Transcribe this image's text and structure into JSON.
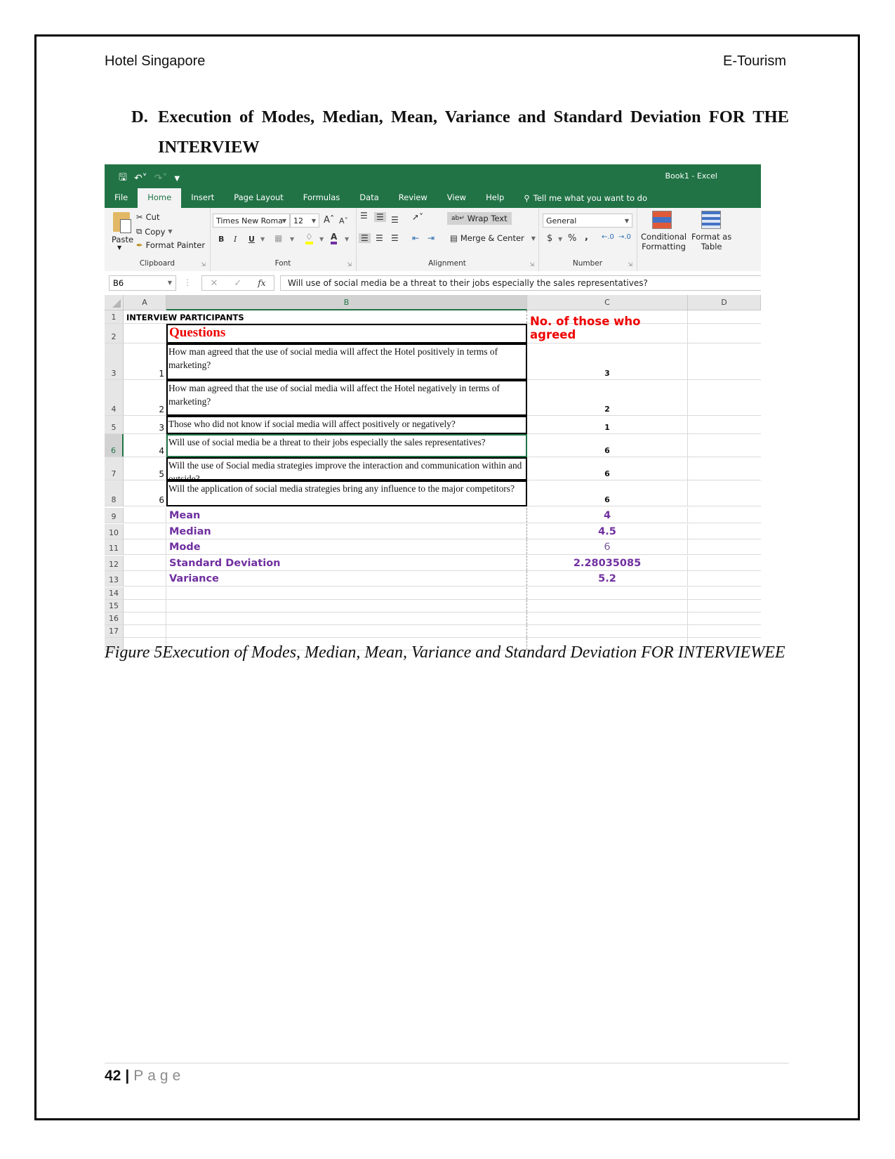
{
  "header": {
    "left": "Hotel Singapore",
    "right": "E-Tourism"
  },
  "heading": {
    "number": "D.",
    "text": "Execution of Modes, Median, Mean, Variance and Standard Deviation FOR THE INTERVIEW"
  },
  "excel": {
    "window_title": "Book1  -  Excel",
    "tabs": [
      "File",
      "Home",
      "Insert",
      "Page Layout",
      "Formulas",
      "Data",
      "Review",
      "View",
      "Help"
    ],
    "active_tab": "Home",
    "tell_me": "Tell me what you want to do",
    "clipboard": {
      "paste": "Paste",
      "cut": "Cut",
      "copy": "Copy",
      "format_painter": "Format Painter",
      "label": "Clipboard"
    },
    "font": {
      "name": "Times New Roma",
      "size": "12",
      "bold": "B",
      "italic": "I",
      "underline": "U",
      "label": "Font"
    },
    "alignment": {
      "wrap_text": "Wrap Text",
      "merge_center": "Merge & Center",
      "label": "Alignment"
    },
    "number": {
      "format": "General",
      "currency": "$",
      "percent": "%",
      "comma": ",",
      "label": "Number"
    },
    "styles": {
      "conditional": "Conditional",
      "formatting": "Formatting",
      "format_as": "Format as",
      "table": "Table"
    },
    "name_box": "B6",
    "formula": "Will use of social media be a threat to their jobs especially the sales representatives?",
    "columns": [
      "A",
      "B",
      "C",
      "D"
    ],
    "row1_title": "INTERVIEW PARTICIPANTS",
    "questions_header": "Questions",
    "agreed_header": "No. of those who agreed",
    "rows": [
      {
        "row": "3",
        "index": "1",
        "question": "How man agreed that the use of social media will affect the Hotel positively in terms of marketing?",
        "value": "3"
      },
      {
        "row": "4",
        "index": "2",
        "question": "How man agreed that the use of social media will affect the Hotel negatively in terms of marketing?",
        "value": "2"
      },
      {
        "row": "5",
        "index": "3",
        "question": " Those who did not know if social media will affect positively or negatively?",
        "value": "1"
      },
      {
        "row": "6",
        "index": "4",
        "question": "Will use of social media be a threat to their jobs especially the sales representatives?",
        "value": "6"
      },
      {
        "row": "7",
        "index": "5",
        "question": "Will the use of Social media strategies improve the interaction and communication within and outside?",
        "value": "6"
      },
      {
        "row": "8",
        "index": "6",
        "question": " Will the application of social media strategies bring any influence to the major competitors?",
        "value": "6"
      }
    ],
    "stats": [
      {
        "row": "9",
        "label": "Mean",
        "value": "4"
      },
      {
        "row": "10",
        "label": "Median",
        "value": "4.5"
      },
      {
        "row": "11",
        "label": "Mode",
        "value": "6"
      },
      {
        "row": "12",
        "label": "Standard Deviation",
        "value": "2.28035085"
      },
      {
        "row": "13",
        "label": "Variance",
        "value": "5.2"
      }
    ],
    "empty_rows": [
      "14",
      "15",
      "16",
      "17"
    ],
    "selected_row": "6",
    "accent": "#217346",
    "stat_color": "#7030a0",
    "header_red": "#ee0000"
  },
  "caption": "Figure 5Execution of Modes, Median, Mean, Variance and Standard Deviation FOR INTERVIEWEE",
  "footer": {
    "page_number": "42",
    "page_label": "Page"
  }
}
